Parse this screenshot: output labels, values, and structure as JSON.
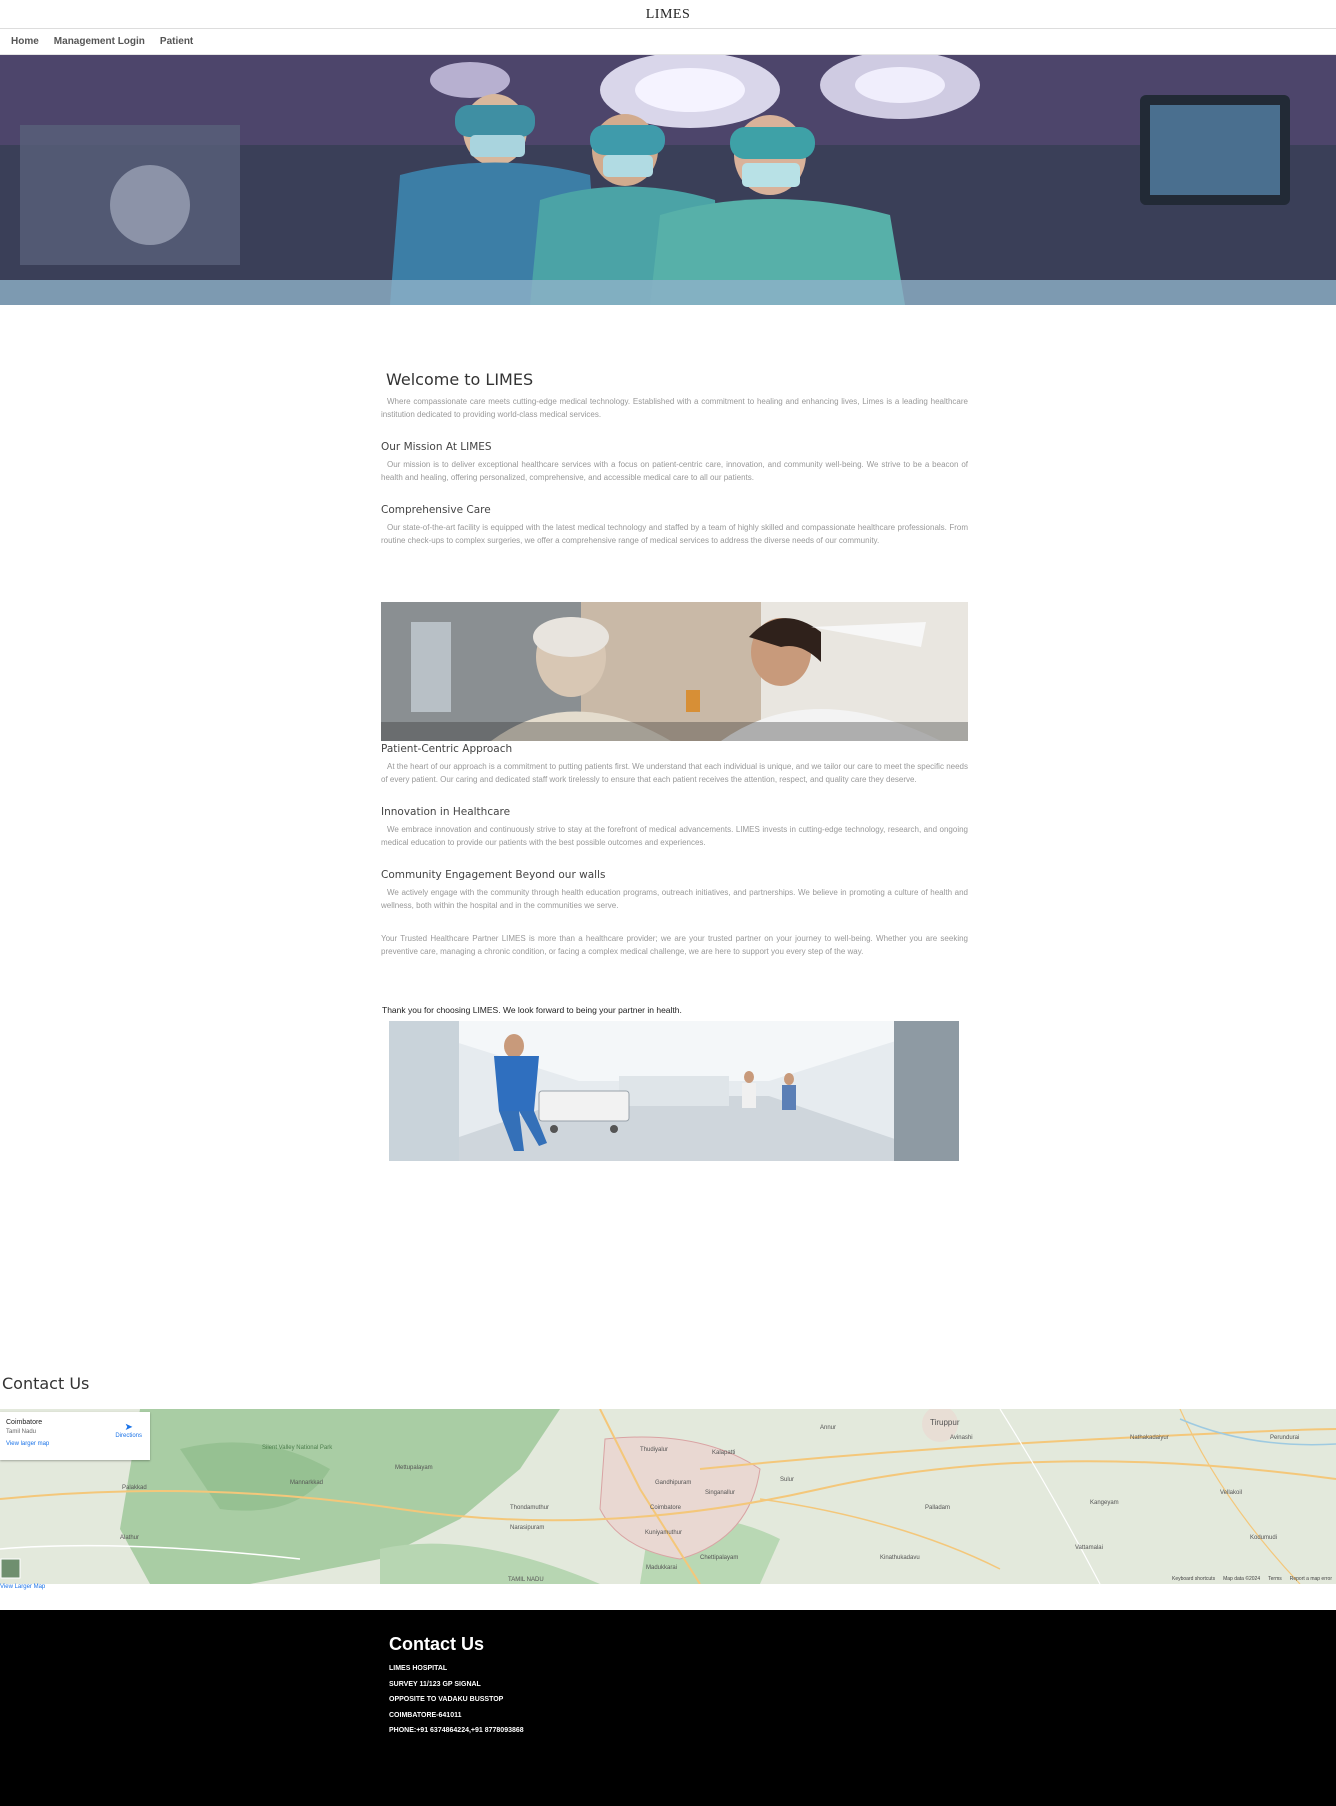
{
  "header": {
    "brand": "LIMES"
  },
  "nav": {
    "items": [
      "Home",
      "Management Login",
      "Patient"
    ]
  },
  "welcome": {
    "title": "Welcome to LIMES",
    "intro": "Where compassionate care meets cutting-edge medical technology. Established with a commitment to healing and enhancing lives, Limes is a leading healthcare institution dedicated to providing world-class medical services."
  },
  "sections": [
    {
      "heading": "Our Mission At LIMES",
      "text": "Our mission is to deliver exceptional healthcare services with a focus on patient-centric care, innovation, and community well-being. We strive to be a beacon of health and healing, offering personalized, comprehensive, and accessible medical care to all our patients."
    },
    {
      "heading": "Comprehensive Care",
      "text": "Our state-of-the-art facility is equipped with the latest medical technology and staffed by a team of highly skilled and compassionate healthcare professionals. From routine check-ups to complex surgeries, we offer a comprehensive range of medical services to address the diverse needs of our community."
    }
  ],
  "sections2": [
    {
      "heading": "Patient-Centric Approach",
      "text": "At the heart of our approach is a commitment to putting patients first. We understand that each individual is unique, and we tailor our care to meet the specific needs of every patient. Our caring and dedicated staff work tirelessly to ensure that each patient receives the attention, respect, and quality care they deserve."
    },
    {
      "heading": "Innovation in Healthcare",
      "text": "We embrace innovation and continuously strive to stay at the forefront of medical advancements. LIMES invests in cutting-edge technology, research, and ongoing medical education to provide our patients with the best possible outcomes and experiences."
    },
    {
      "heading": "Community Engagement Beyond our walls",
      "text": "We actively engage with the community through health education programs, outreach initiatives, and partnerships. We believe in promoting a culture of health and wellness, both within the hospital and in the communities we serve."
    }
  ],
  "partner": "Your Trusted Healthcare Partner LIMES is more than a healthcare provider; we are your trusted partner on your journey to well-being. Whether you are seeking preventive care, managing a chronic condition, or facing a complex medical challenge, we are here to support you every step of the way.",
  "thanks": "Thank you for choosing LIMES. We look forward to being your partner in health.",
  "contact": {
    "title": "Contact Us",
    "map": {
      "place": "Coimbatore",
      "region": "Tamil Nadu",
      "larger_link": "View larger map",
      "directions": "Directions",
      "bottom_link": "View Larger Map",
      "footer_items": [
        "Keyboard shortcuts",
        "Map data ©2024",
        "Terms",
        "Report a map error"
      ],
      "labels": [
        "Thudiyalur",
        "Kalapatti",
        "Coimbatore",
        "Gandhipuram",
        "Singanallur",
        "Kuniyamuthur",
        "Madukkarai",
        "Tiruppur",
        "Palladam",
        "Sulur",
        "Annur",
        "Avinashi",
        "Mettupalayam",
        "Mannarkkad",
        "Palakkad",
        "Alathur",
        "Chettipalayam",
        "Kinathukadavu",
        "Nathakadaiyur",
        "Kangeyam",
        "Kodumudi",
        "Vellakoil",
        "Perundurai",
        "Vattamalai",
        "Thondamuthur",
        "Narasipuram",
        "Silent Valley National Park",
        "TAMIL NADU"
      ],
      "colors": {
        "land": "#dfe6d6",
        "forest": "#a5c9a0",
        "water": "#9ecae1",
        "road": "#f4c77a",
        "city": "#e8d6d0"
      }
    }
  },
  "footer": {
    "title": "Contact Us",
    "lines": [
      "LIMES HOSPITAL",
      "SURVEY 11/123 GP SIGNAL",
      "OPPOSITE TO VADAKU BUSSTOP",
      "COIMBATORE-641011",
      "PHONE:+91 6374864224,+91 8778093868"
    ]
  },
  "colors": {
    "footer_bg": "#000000",
    "link": "#1a73e8",
    "body_text": "#999999"
  }
}
